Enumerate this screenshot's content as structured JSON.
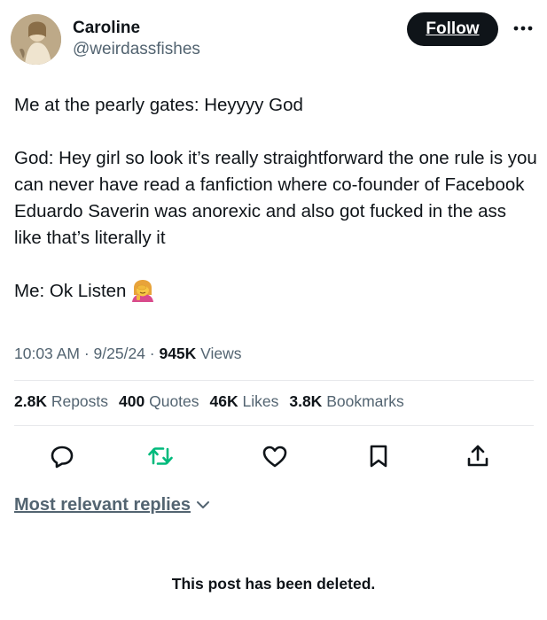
{
  "user": {
    "display_name": "Caroline",
    "handle": "@weirdassfishes",
    "avatar_icon": "avatar-portrait-icon"
  },
  "header": {
    "follow_label": "Follow",
    "more_icon": "more-dots-icon"
  },
  "tweet": {
    "paragraphs": [
      "Me at the pearly gates: Heyyyy God",
      "God: Hey girl so look it’s really straightforward the one rule is you can never have read a fanfiction where co-founder of Facebook Eduardo Saverin was anorexic and also got fucked in the ass like that’s literally it",
      "Me: Ok Listen"
    ],
    "emoji_icon": "facepalm-emoji-icon"
  },
  "meta": {
    "time": "10:03 AM",
    "sep1": " · ",
    "date": "9/25/24",
    "sep2": " · ",
    "views_count": "945K",
    "views_label": " Views"
  },
  "stats": {
    "reposts_count": "2.8K",
    "reposts_label": " Reposts",
    "quotes_count": "400",
    "quotes_label": " Quotes",
    "likes_count": "46K",
    "likes_label": " Likes",
    "bookmarks_count": "3.8K",
    "bookmarks_label": " Bookmarks"
  },
  "actions": {
    "icons": [
      "reply-icon",
      "repost-icon",
      "like-icon",
      "bookmark-icon",
      "share-icon"
    ],
    "repost_color": "#00ba7c",
    "default_color": "#536471"
  },
  "replies": {
    "sort_label": "Most relevant replies",
    "chevron_icon": "chevron-down-icon"
  },
  "deleted_notice": "This post has been deleted."
}
